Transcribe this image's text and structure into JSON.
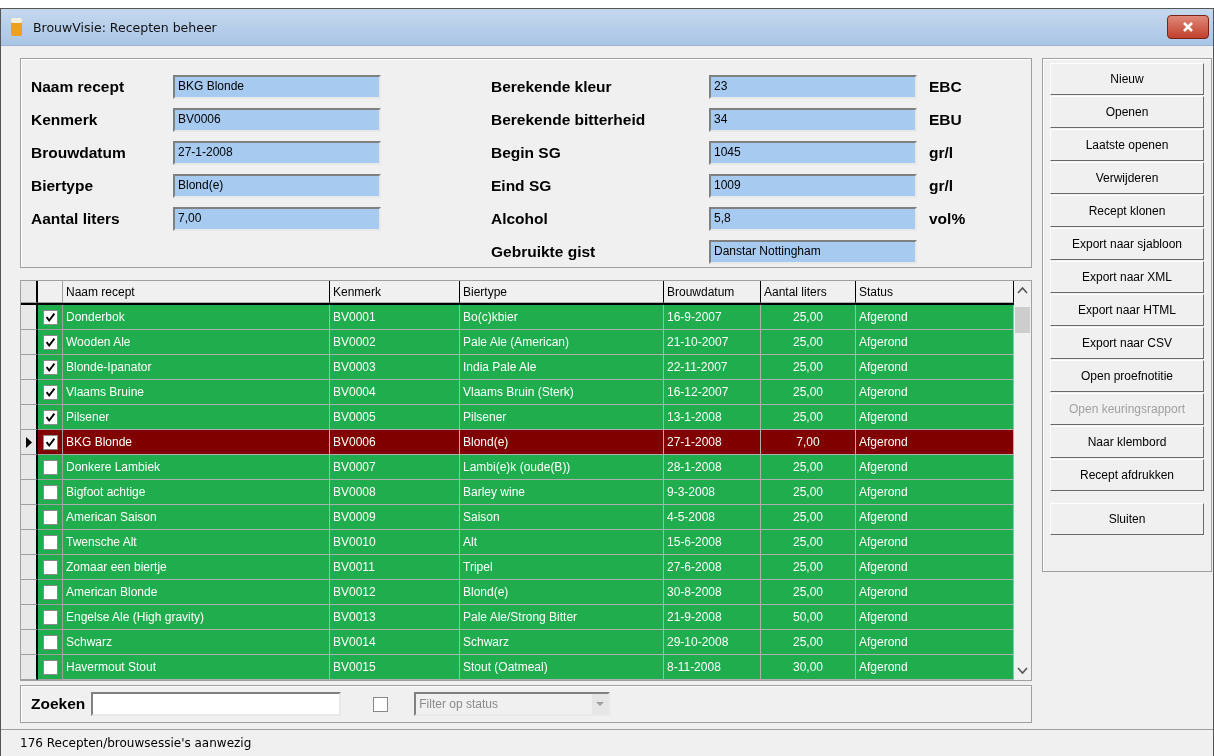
{
  "window": {
    "title": "BrouwVisie: Recepten beheer"
  },
  "form_left": [
    {
      "label": "Naam recept",
      "value": "BKG Blonde"
    },
    {
      "label": "Kenmerk",
      "value": "BV0006"
    },
    {
      "label": "Brouwdatum",
      "value": "27-1-2008"
    },
    {
      "label": "Biertype",
      "value": "Blond(e)"
    },
    {
      "label": "Aantal liters",
      "value": "7,00"
    }
  ],
  "form_right": [
    {
      "label": "Berekende kleur",
      "value": "23",
      "unit": "EBC"
    },
    {
      "label": "Berekende bitterheid",
      "value": "34",
      "unit": "EBU"
    },
    {
      "label": "Begin SG",
      "value": "1045",
      "unit": "gr/l"
    },
    {
      "label": "Eind SG",
      "value": "1009",
      "unit": "gr/l"
    },
    {
      "label": "Alcohol",
      "value": "5,8",
      "unit": "vol%"
    },
    {
      "label": "Gebruikte gist",
      "value": "Danstar Nottingham"
    }
  ],
  "table": {
    "columns": [
      "Naam recept",
      "Kenmerk",
      "Biertype",
      "Brouwdatum",
      "Aantal liters",
      "Status"
    ],
    "rows": [
      {
        "checked": true,
        "selected": false,
        "cells": [
          "Donderbok",
          "BV0001",
          "Bo(c)kbier",
          "16-9-2007",
          "25,00",
          "Afgerond"
        ]
      },
      {
        "checked": true,
        "selected": false,
        "cells": [
          "Wooden Ale",
          "BV0002",
          "Pale Ale (American)",
          "21-10-2007",
          "25,00",
          "Afgerond"
        ]
      },
      {
        "checked": true,
        "selected": false,
        "cells": [
          "Blonde-Ipanator",
          "BV0003",
          "India Pale Ale",
          "22-11-2007",
          "25,00",
          "Afgerond"
        ]
      },
      {
        "checked": true,
        "selected": false,
        "cells": [
          "Vlaams Bruine",
          "BV0004",
          "Vlaams Bruin (Sterk)",
          "16-12-2007",
          "25,00",
          "Afgerond"
        ]
      },
      {
        "checked": true,
        "selected": false,
        "cells": [
          "Pilsener",
          "BV0005",
          "Pilsener",
          "13-1-2008",
          "25,00",
          "Afgerond"
        ]
      },
      {
        "checked": true,
        "selected": true,
        "cells": [
          "BKG Blonde",
          "BV0006",
          "Blond(e)",
          "27-1-2008",
          "7,00",
          "Afgerond"
        ]
      },
      {
        "checked": false,
        "selected": false,
        "cells": [
          "Donkere Lambiek",
          "BV0007",
          "Lambi(e)k (oude(B))",
          "28-1-2008",
          "25,00",
          "Afgerond"
        ]
      },
      {
        "checked": false,
        "selected": false,
        "cells": [
          "Bigfoot achtige",
          "BV0008",
          "Barley wine",
          "9-3-2008",
          "25,00",
          "Afgerond"
        ]
      },
      {
        "checked": false,
        "selected": false,
        "cells": [
          "American Saison",
          "BV0009",
          "Saison",
          "4-5-2008",
          "25,00",
          "Afgerond"
        ]
      },
      {
        "checked": false,
        "selected": false,
        "cells": [
          "Twensche Alt",
          "BV0010",
          "Alt",
          "15-6-2008",
          "25,00",
          "Afgerond"
        ]
      },
      {
        "checked": false,
        "selected": false,
        "cells": [
          "Zomaar een biertje",
          "BV0011",
          "Tripel",
          "27-6-2008",
          "25,00",
          "Afgerond"
        ]
      },
      {
        "checked": false,
        "selected": false,
        "cells": [
          "American Blonde",
          "BV0012",
          "Blond(e)",
          "30-8-2008",
          "25,00",
          "Afgerond"
        ]
      },
      {
        "checked": false,
        "selected": false,
        "cells": [
          "Engelse Ale (High gravity)",
          "BV0013",
          "Pale Ale/Strong Bitter",
          "21-9-2008",
          "50,00",
          "Afgerond"
        ]
      },
      {
        "checked": false,
        "selected": false,
        "cells": [
          "Schwarz",
          "BV0014",
          "Schwarz",
          "29-10-2008",
          "25,00",
          "Afgerond"
        ]
      },
      {
        "checked": false,
        "selected": false,
        "cells": [
          "Havermout Stout",
          "BV0015",
          "Stout (Oatmeal)",
          "8-11-2008",
          "30,00",
          "Afgerond"
        ]
      }
    ]
  },
  "search": {
    "label": "Zoeken",
    "filter_checked": false,
    "filter_placeholder": "Filter op status"
  },
  "buttons": [
    {
      "label": "Nieuw",
      "disabled": false
    },
    {
      "label": "Openen",
      "disabled": false
    },
    {
      "label": "Laatste openen",
      "disabled": false
    },
    {
      "label": "Verwijderen",
      "disabled": false
    },
    {
      "label": "Recept klonen",
      "disabled": false
    },
    {
      "label": "Export naar sjabloon",
      "disabled": false
    },
    {
      "label": "Export naar XML",
      "disabled": false
    },
    {
      "label": "Export naar HTML",
      "disabled": false
    },
    {
      "label": "Export naar CSV",
      "disabled": false
    },
    {
      "label": "Open proefnotitie",
      "disabled": false
    },
    {
      "label": "Open keuringsrapport",
      "disabled": true
    },
    {
      "label": "Naar klembord",
      "disabled": false
    },
    {
      "label": "Recept afdrukken",
      "disabled": false
    }
  ],
  "close_button": {
    "label": "Sluiten"
  },
  "status_bar": "176 Recepten/brouwsessie's aanwezig"
}
